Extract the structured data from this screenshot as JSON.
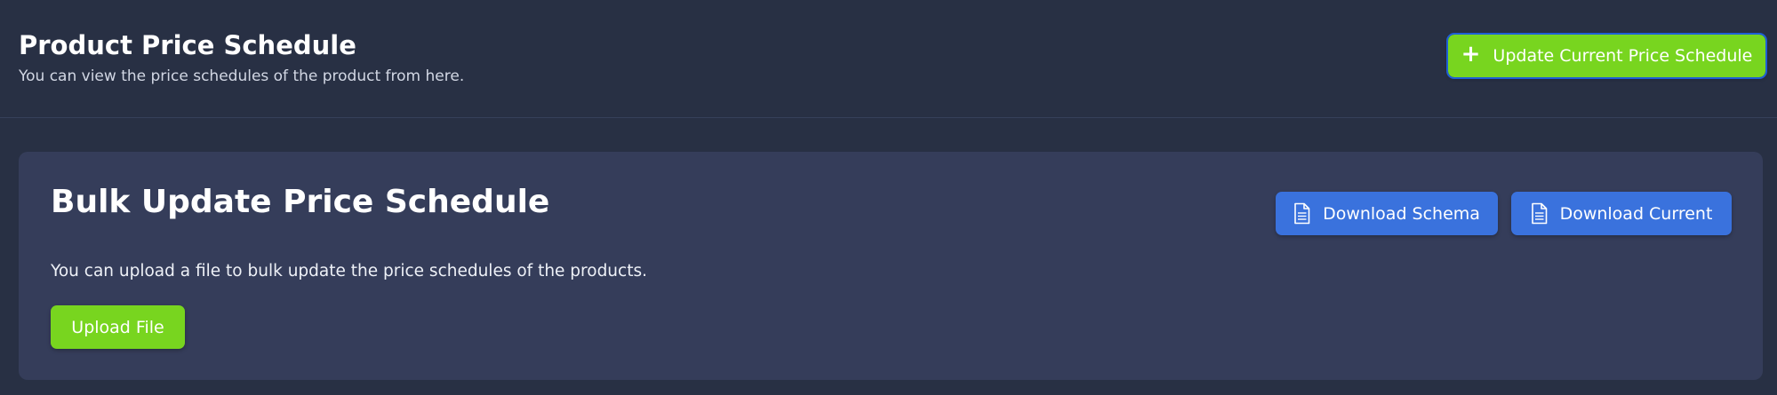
{
  "header": {
    "title": "Product Price Schedule",
    "subtitle": "You can view the price schedules of the product from here.",
    "update_button": {
      "icon": "plus-icon",
      "label": "Update Current Price Schedule"
    }
  },
  "bulk_update": {
    "title": "Bulk Update Price Schedule",
    "description": "You can upload a file to bulk update the price schedules of the products.",
    "upload_button": "Upload File",
    "download_schema_button": {
      "icon": "document-icon",
      "label": "Download Schema"
    },
    "download_current_button": {
      "icon": "document-icon",
      "label": "Download Current"
    }
  },
  "colors": {
    "background": "#283044",
    "card": "#353d5a",
    "accent_green": "#78d51f",
    "accent_blue": "#3a72dd"
  }
}
